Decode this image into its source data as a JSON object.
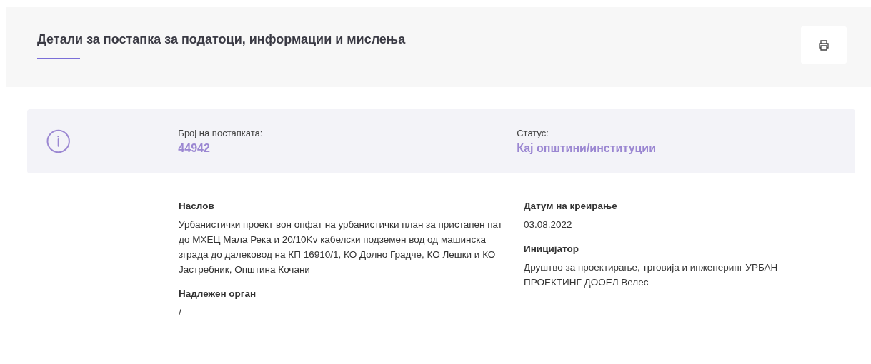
{
  "header": {
    "title": "Детали за постапка за податоци, информации и мислења"
  },
  "summary": {
    "number_label": "Број на постапката:",
    "number": "44942",
    "status_label": "Статус:",
    "status": "Кај општини/институции"
  },
  "details": {
    "left": [
      {
        "label": "Наслов",
        "value": "Урбанистички проект вон опфат на урбанистички план за пристапен пат до МХЕЦ Мала Река и 20/10Kv кабелски подземен вод од машинска зграда до далековод на КП 16910/1, КО Долно Градче, КО Лешки и КО Јастребник, Општина Кочани"
      },
      {
        "label": "Надлежен орган",
        "value": "/"
      }
    ],
    "right": [
      {
        "label": "Датум на креирање",
        "value": "03.08.2022"
      },
      {
        "label": "Иницијатор",
        "value": "Друштво за проектирање, трговија и инженеринг УРБАН ПРОЕКТИНГ ДООЕЛ Велес"
      }
    ]
  }
}
